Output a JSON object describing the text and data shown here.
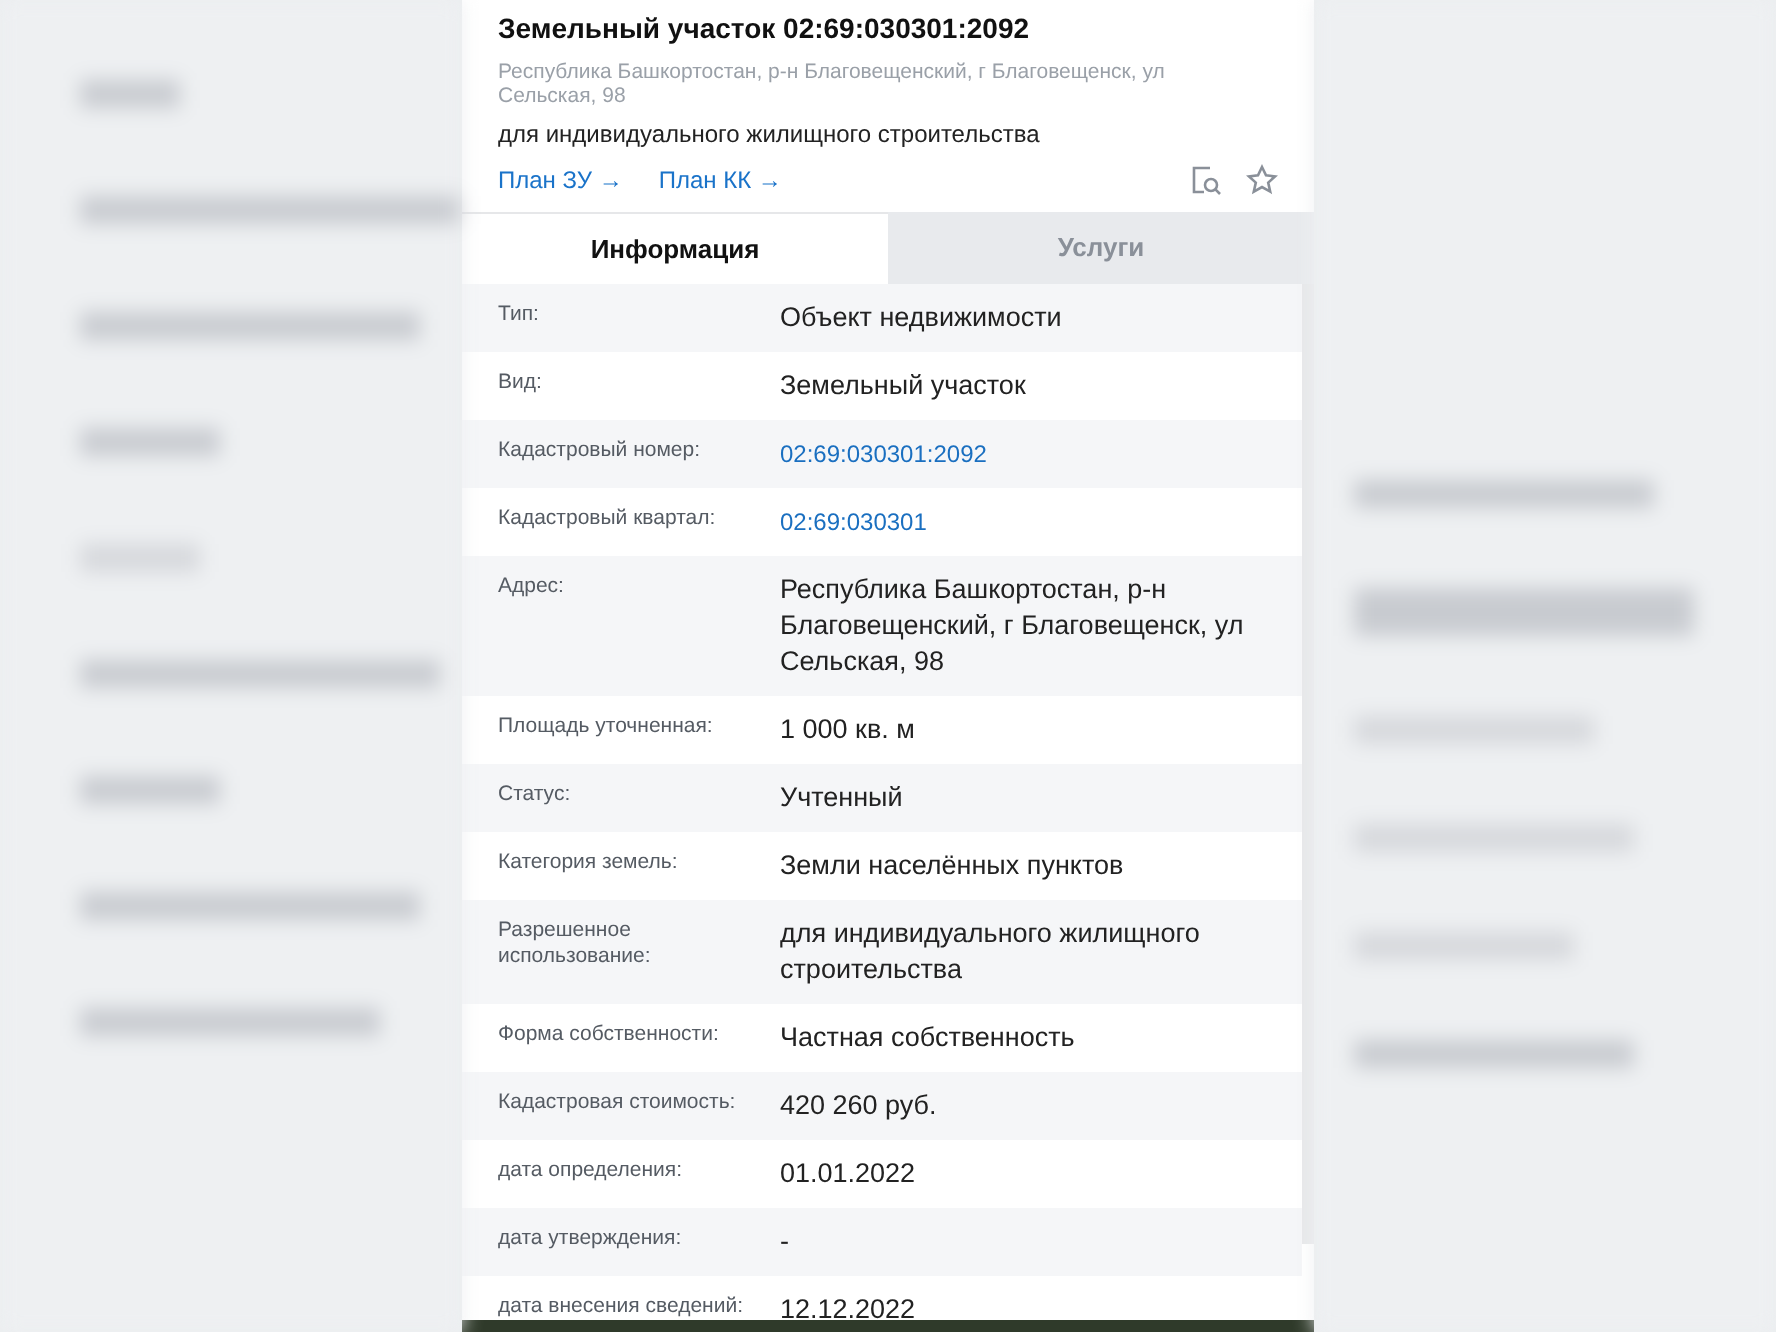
{
  "header": {
    "title": "Земельный участок 02:69:030301:2092",
    "address": "Республика Башкортостан, р-н Благовещенский, г Благовещенск, ул Сельская, 98",
    "purpose": "для индивидуального жилищного строительства",
    "links": [
      "План ЗУ →",
      "План КК →"
    ]
  },
  "tabs": [
    {
      "label": "Информация",
      "selected": true
    },
    {
      "label": "Услуги",
      "selected": false
    }
  ],
  "rows": [
    {
      "label": "Тип:",
      "value": "Объект недвижимости",
      "kind": "text"
    },
    {
      "label": "Вид:",
      "value": "Земельный участок",
      "kind": "text"
    },
    {
      "label": "Кадастровый номер:",
      "value": "02:69:030301:2092",
      "kind": "link"
    },
    {
      "label": "Кадастровый квартал:",
      "value": "02:69:030301",
      "kind": "link"
    },
    {
      "label": "Адрес:",
      "value": "Республика Башкортостан, р-н Благовещенский, г Благовещенск, ул Сельская, 98",
      "kind": "text"
    },
    {
      "label": "Площадь уточненная:",
      "value": "1 000 кв. м",
      "kind": "text"
    },
    {
      "label": "Статус:",
      "value": "Учтенный",
      "kind": "text"
    },
    {
      "label": "Категория земель:",
      "value": "Земли населённых пунктов",
      "kind": "text"
    },
    {
      "label": "Разрешенное использование:",
      "value": "для индивидуального жилищного строительства",
      "kind": "text"
    },
    {
      "label": "Форма собственности:",
      "value": "Частная собственность",
      "kind": "text"
    },
    {
      "label": "Кадастровая стоимость:",
      "value": "420 260 руб.",
      "kind": "text"
    },
    {
      "label": "дата определения:",
      "value": "01.01.2022",
      "kind": "text"
    },
    {
      "label": "дата утверждения:",
      "value": "-",
      "kind": "text"
    },
    {
      "label": "дата внесения сведений:",
      "value": "12.12.2022",
      "kind": "text"
    }
  ]
}
